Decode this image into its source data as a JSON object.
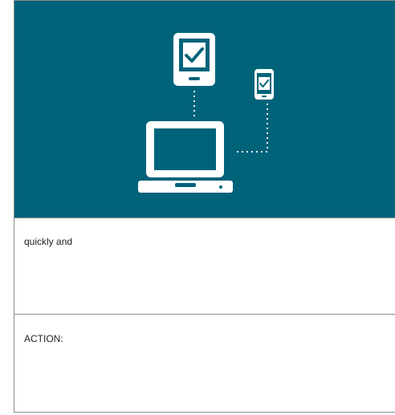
{
  "colors": {
    "hero_background": "#00637a",
    "illustration": "#ffffff",
    "border": "#8c8c8c",
    "text": "#222222"
  },
  "hero": {
    "icons": [
      "tablet-check-icon",
      "phone-check-icon",
      "laptop-icon"
    ]
  },
  "rows": [
    {
      "text": "quickly and"
    },
    {
      "text": "ACTION:"
    }
  ]
}
